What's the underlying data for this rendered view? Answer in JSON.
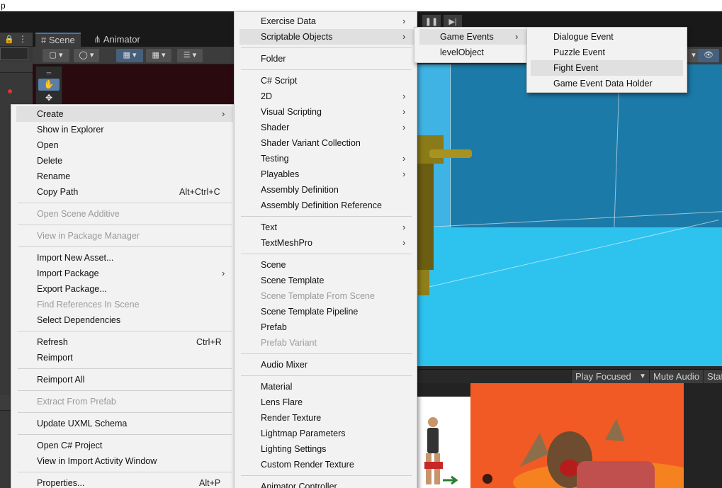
{
  "window": {
    "title_fragment": "p"
  },
  "scene_tabs": [
    {
      "label": "Scene"
    },
    {
      "label": "Animator"
    }
  ],
  "game_view": {
    "play_focused_label": "Play Focused",
    "mute_audio_label": "Mute Audio",
    "stats_label": "Stat"
  },
  "menus": {
    "asset_context": {
      "items": [
        {
          "label": "Create",
          "submenu": true,
          "highlighted": true
        },
        {
          "label": "Show in Explorer"
        },
        {
          "label": "Open"
        },
        {
          "label": "Delete"
        },
        {
          "label": "Rename"
        },
        {
          "label": "Copy Path",
          "shortcut": "Alt+Ctrl+C"
        },
        {
          "label": "Open Scene Additive",
          "disabled": true
        },
        {
          "label": "View in Package Manager",
          "disabled": true
        },
        {
          "label": "Import New Asset..."
        },
        {
          "label": "Import Package",
          "submenu": true
        },
        {
          "label": "Export Package..."
        },
        {
          "label": "Find References In Scene",
          "disabled": true
        },
        {
          "label": "Select Dependencies"
        },
        {
          "label": "Refresh",
          "shortcut": "Ctrl+R"
        },
        {
          "label": "Reimport"
        },
        {
          "label": "Reimport All"
        },
        {
          "label": "Extract From Prefab",
          "disabled": true
        },
        {
          "label": "Update UXML Schema"
        },
        {
          "label": "Open C# Project"
        },
        {
          "label": "View in Import Activity Window"
        },
        {
          "label": "Properties...",
          "shortcut": "Alt+P"
        }
      ]
    },
    "create": {
      "items": [
        {
          "label": "Exercise Data",
          "submenu": true
        },
        {
          "label": "Scriptable Objects",
          "submenu": true,
          "highlighted": true
        },
        {
          "label": "Folder"
        },
        {
          "label": "C# Script"
        },
        {
          "label": "2D",
          "submenu": true
        },
        {
          "label": "Visual Scripting",
          "submenu": true
        },
        {
          "label": "Shader",
          "submenu": true
        },
        {
          "label": "Shader Variant Collection"
        },
        {
          "label": "Testing",
          "submenu": true
        },
        {
          "label": "Playables",
          "submenu": true
        },
        {
          "label": "Assembly Definition"
        },
        {
          "label": "Assembly Definition Reference"
        },
        {
          "label": "Text",
          "submenu": true
        },
        {
          "label": "TextMeshPro",
          "submenu": true
        },
        {
          "label": "Scene"
        },
        {
          "label": "Scene Template"
        },
        {
          "label": "Scene Template From Scene",
          "disabled": true
        },
        {
          "label": "Scene Template Pipeline"
        },
        {
          "label": "Prefab"
        },
        {
          "label": "Prefab Variant",
          "disabled": true
        },
        {
          "label": "Audio Mixer"
        },
        {
          "label": "Material"
        },
        {
          "label": "Lens Flare"
        },
        {
          "label": "Render Texture"
        },
        {
          "label": "Lightmap Parameters"
        },
        {
          "label": "Lighting Settings"
        },
        {
          "label": "Custom Render Texture"
        },
        {
          "label": "Animator Controller"
        }
      ]
    },
    "scriptable_objects": {
      "items": [
        {
          "label": "Game Events",
          "submenu": true,
          "highlighted": true
        },
        {
          "label": "levelObject"
        }
      ]
    },
    "game_events": {
      "items": [
        {
          "label": "Dialogue Event"
        },
        {
          "label": "Puzzle Event"
        },
        {
          "label": "Fight Event",
          "highlighted": true
        },
        {
          "label": "Game Event Data Holder"
        }
      ]
    }
  },
  "colors": {
    "menu_bg": "#f2f2f2",
    "menu_highlight": "#e0e0e0",
    "disabled_text": "#9a9a9a",
    "viewport_floor": "#2ec2ef",
    "game_bg": "#f15a24"
  }
}
